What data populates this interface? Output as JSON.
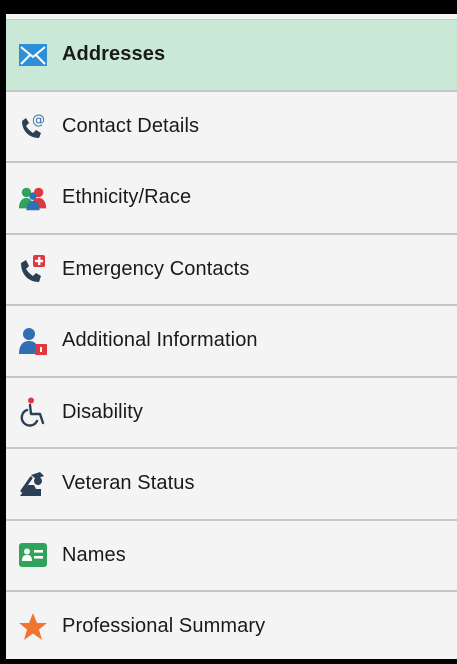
{
  "nav": {
    "items": [
      {
        "label": "Addresses",
        "icon": "envelope-icon",
        "active": true
      },
      {
        "label": "Contact Details",
        "icon": "phone-at-icon"
      },
      {
        "label": "Ethnicity/Race",
        "icon": "people-icon"
      },
      {
        "label": "Emergency Contacts",
        "icon": "emergency-phone-icon"
      },
      {
        "label": "Additional Information",
        "icon": "person-lock-icon"
      },
      {
        "label": "Disability",
        "icon": "wheelchair-icon"
      },
      {
        "label": "Veteran Status",
        "icon": "veteran-salute-icon"
      },
      {
        "label": "Names",
        "icon": "id-card-icon"
      },
      {
        "label": "Professional Summary",
        "icon": "star-icon"
      }
    ]
  },
  "colors": {
    "active_background": "#c9e9d6",
    "icon_blue": "#2f6fb6",
    "icon_dark": "#2b3f55",
    "icon_red": "#e0383e",
    "icon_orange": "#f0752f",
    "icon_green": "#2fa35b"
  }
}
